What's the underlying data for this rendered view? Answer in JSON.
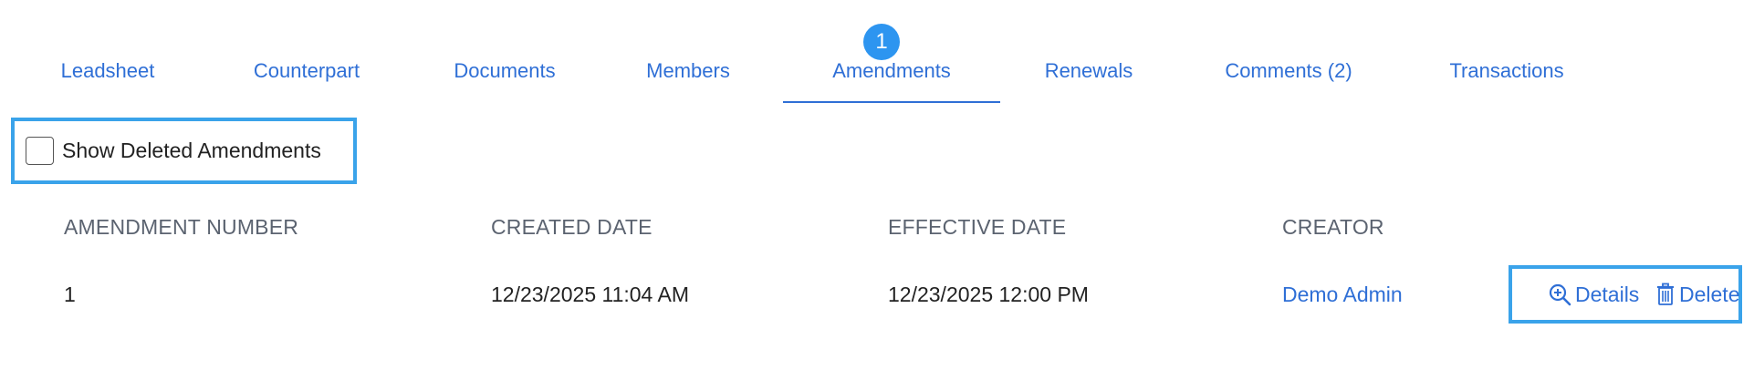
{
  "tabs": {
    "items": [
      {
        "label": "Leadsheet"
      },
      {
        "label": "Counterpart"
      },
      {
        "label": "Documents"
      },
      {
        "label": "Members"
      },
      {
        "label": "Amendments",
        "active": true
      },
      {
        "label": "Renewals"
      },
      {
        "label": "Comments (2)"
      },
      {
        "label": "Transactions"
      }
    ],
    "active_badge": "1"
  },
  "filter": {
    "show_deleted_label": "Show Deleted Amendments",
    "checked": false
  },
  "table": {
    "headers": [
      "AMENDMENT NUMBER",
      "CREATED DATE",
      "EFFECTIVE DATE",
      "CREATOR"
    ],
    "rows": [
      {
        "number": "1",
        "created": "12/23/2025 11:04 AM",
        "effective": "12/23/2025 12:00 PM",
        "creator": "Demo Admin"
      }
    ],
    "actions": {
      "details_label": "Details",
      "delete_label": "Delete"
    }
  },
  "colors": {
    "link": "#2f6fd6",
    "badge": "#2d95f0",
    "highlight": "#3aa3ea",
    "header_text": "#5b6370"
  }
}
